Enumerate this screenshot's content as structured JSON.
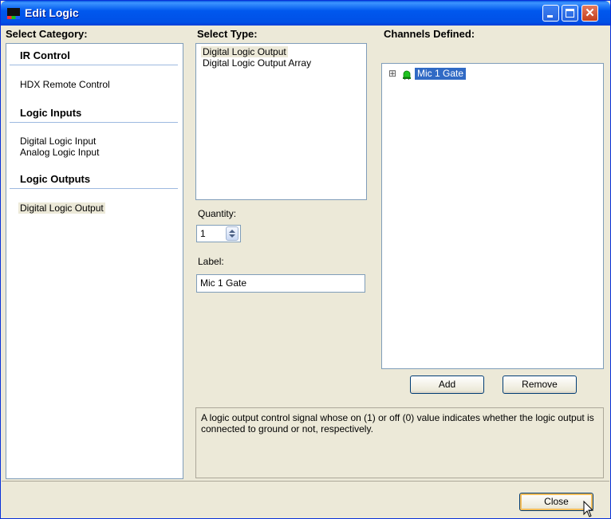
{
  "window": {
    "title": "Edit Logic"
  },
  "category": {
    "heading": "Select Category:",
    "groups": [
      {
        "title": "IR Control",
        "items": [
          "HDX Remote Control"
        ]
      },
      {
        "title": "Logic Inputs",
        "items": [
          "Digital Logic Input",
          "Analog Logic Input"
        ]
      },
      {
        "title": "Logic Outputs",
        "items": [
          "Digital Logic Output"
        ]
      }
    ],
    "selected": "Digital Logic Output"
  },
  "type": {
    "heading": "Select Type:",
    "items": [
      "Digital Logic Output",
      "Digital Logic Output Array"
    ],
    "selected": "Digital Logic Output"
  },
  "quantity": {
    "label": "Quantity:",
    "value": "1"
  },
  "label_field": {
    "label": "Label:",
    "value": "Mic 1 Gate"
  },
  "channels": {
    "heading": "Channels Defined:",
    "items": [
      {
        "label": "Mic 1 Gate",
        "expand_glyph": "⊞",
        "icon": "green-led-icon",
        "selected": true
      }
    ],
    "add_label": "Add",
    "remove_label": "Remove"
  },
  "description": "A logic output control signal whose on (1) or off (0) value indicates whether the logic output is connected to ground or not, respectively.",
  "footer": {
    "close_label": "Close"
  },
  "colors": {
    "titlebar": "#0058ee",
    "selection": "#316ac5",
    "led": "#1ec21e",
    "panel_border": "#7f9db9"
  }
}
